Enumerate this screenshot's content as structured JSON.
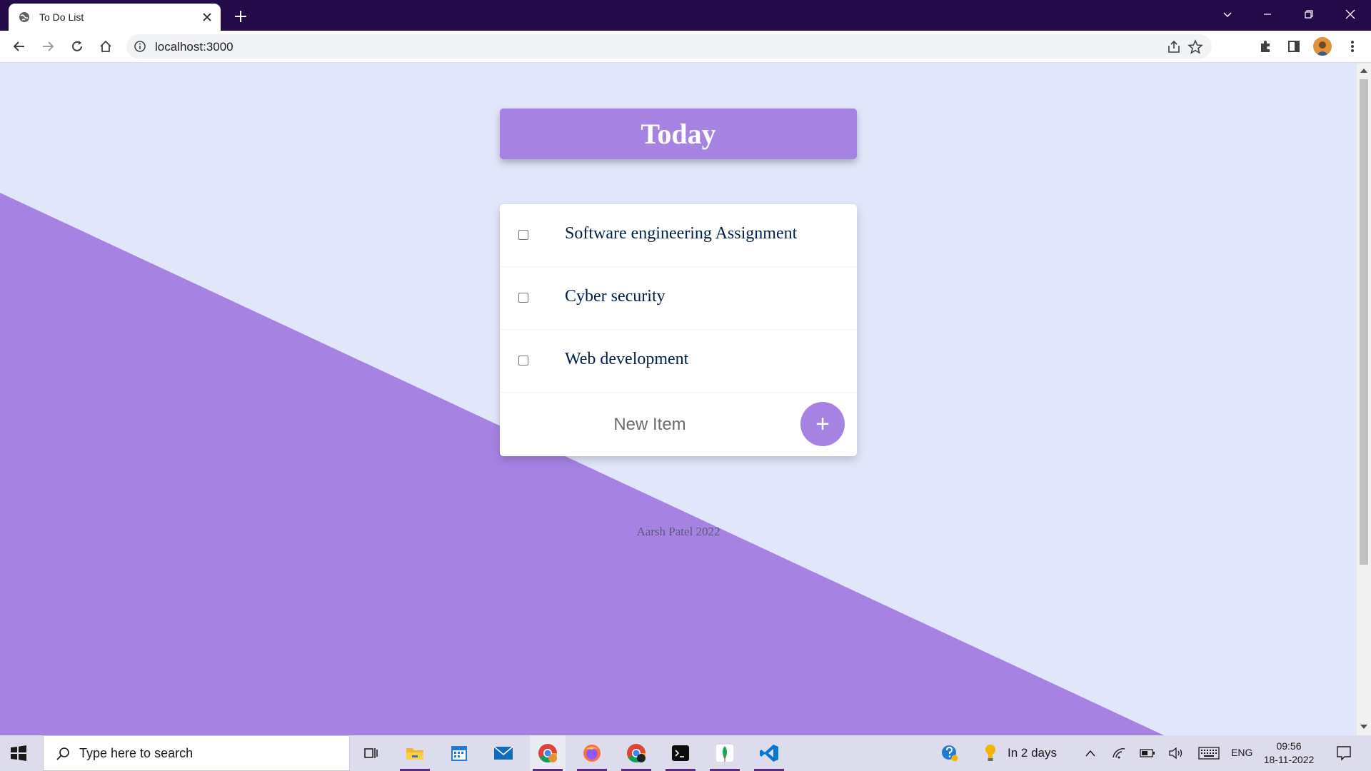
{
  "browser": {
    "tab_title": "To Do List",
    "url": "localhost:3000"
  },
  "page": {
    "heading": "Today",
    "items": [
      {
        "label": "Software engineering Assignment",
        "checked": false
      },
      {
        "label": "Cyber security",
        "checked": false
      },
      {
        "label": "Web development",
        "checked": false
      }
    ],
    "new_item_placeholder": "New Item",
    "add_button_label": "+",
    "footer": "Aarsh Patel 2022"
  },
  "taskbar": {
    "search_placeholder": "Type here to search",
    "weather_text": "In 2 days",
    "language": "ENG",
    "time": "09:56",
    "date": "18-11-2022"
  },
  "colors": {
    "accent": "#a683e3",
    "page_bg": "#e2e6fa",
    "title_bar": "#240a48",
    "item_text": "#00204a"
  }
}
